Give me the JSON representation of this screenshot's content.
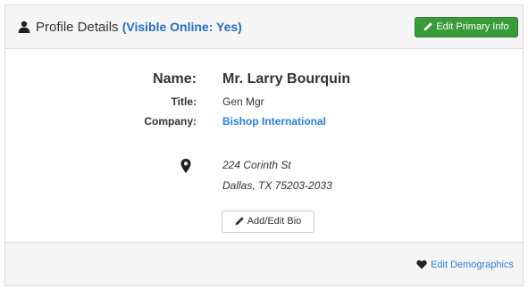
{
  "header": {
    "title": "Profile Details",
    "visible_status": "(Visible Online: Yes)",
    "edit_button_label": "Edit Primary Info",
    "edit_button_color": "#3a9b3a"
  },
  "profile": {
    "name_label": "Name:",
    "name_value": "Mr. Larry Bourquin",
    "title_label": "Title:",
    "title_value": "Gen Mgr",
    "company_label": "Company:",
    "company_value": "Bishop International",
    "address_line1": "224 Corinth St",
    "address_line2": "Dallas, TX 75203-2033",
    "bio_button_label": "Add/Edit Bio"
  },
  "footer": {
    "demographics_link_label": "Edit Demographics"
  },
  "colors": {
    "link": "#2a7fd4",
    "status": "#2a6ebb",
    "panel_bg": "#f5f5f5"
  },
  "icons": {
    "header_icon": "user-icon",
    "edit_icon": "pencil-icon",
    "address_icon": "map-marker-icon",
    "demographics_icon": "heart-icon"
  }
}
